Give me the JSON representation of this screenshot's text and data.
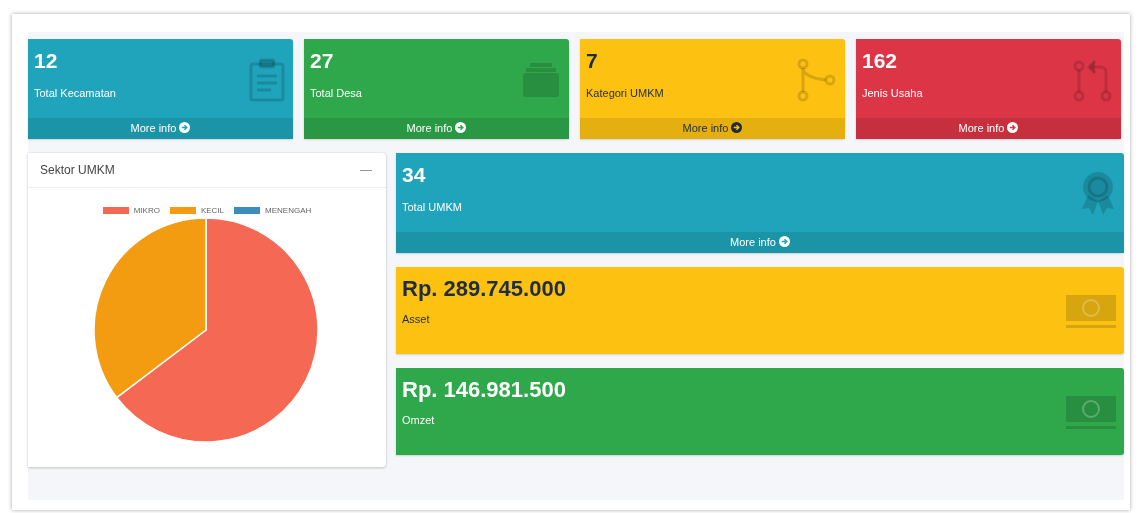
{
  "stat_boxes": [
    {
      "value": "12",
      "label": "Total Kecamatan",
      "link": "More info",
      "color": "#1fa4bb"
    },
    {
      "value": "27",
      "label": "Total Desa",
      "link": "More info",
      "color": "#2ea84a"
    },
    {
      "value": "7",
      "label": "Kategori UMKM",
      "link": "More info",
      "color": "#fdc211"
    },
    {
      "value": "162",
      "label": "Jenis Usaha",
      "link": "More info",
      "color": "#dc3545"
    }
  ],
  "chart_card": {
    "title": "Sektor UMKM",
    "collapse": "—",
    "chart_data": {
      "type": "pie",
      "categories": [
        "MIKRO",
        "KECIL",
        "MENENGAH"
      ],
      "values": [
        64.7,
        35.3,
        0
      ],
      "colors": [
        "#f56954",
        "#f39c12",
        "#3c8dbc"
      ],
      "legend": "top"
    }
  },
  "total_box": {
    "value": "34",
    "label": "Total UMKM",
    "link": "More info",
    "color": "#1fa4bb"
  },
  "money_boxes": [
    {
      "value": "Rp. 289.745.000",
      "label": "Asset",
      "color": "#fdc211"
    },
    {
      "value": "Rp. 146.981.500",
      "label": "Omzet",
      "color": "#2ea84a"
    }
  ]
}
